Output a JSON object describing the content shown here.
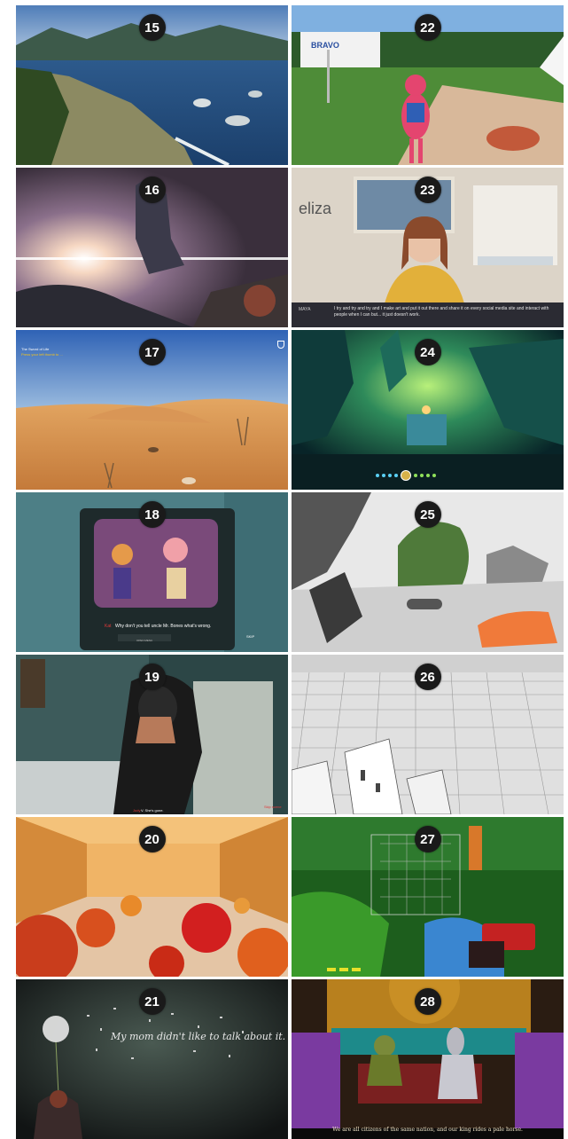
{
  "tiles": [
    {
      "number": "15"
    },
    {
      "number": "16"
    },
    {
      "number": "17",
      "hud_title": "The Sword of Life",
      "hud_hint": "Press your left thumb to ..."
    },
    {
      "number": "18",
      "subtitle_speaker": "Kat",
      "subtitle_text": "Why don't you tell uncle Mr. Bones what's wrong.",
      "hud_right": "SKIP",
      "button_label": "OPEN MENU"
    },
    {
      "number": "19",
      "subtitle_speaker": "Judy",
      "subtitle_text": "V. She's gone.",
      "hud_right": "Skip scene"
    },
    {
      "number": "20"
    },
    {
      "number": "21",
      "caption": "My mom didn't like to talk about it."
    },
    {
      "number": "22",
      "sign": "BRAVO"
    },
    {
      "number": "23",
      "brand": "eliza",
      "speaker": "MAYA",
      "dialogue": "I try and try and try and I make art and put it out there and share it on every social media site and interact with people when I can but... it just doesn't work."
    },
    {
      "number": "24"
    },
    {
      "number": "25"
    },
    {
      "number": "26"
    },
    {
      "number": "27"
    },
    {
      "number": "28",
      "caption": "We are all citizens of the same nation, and our king rides a pale horse."
    }
  ]
}
